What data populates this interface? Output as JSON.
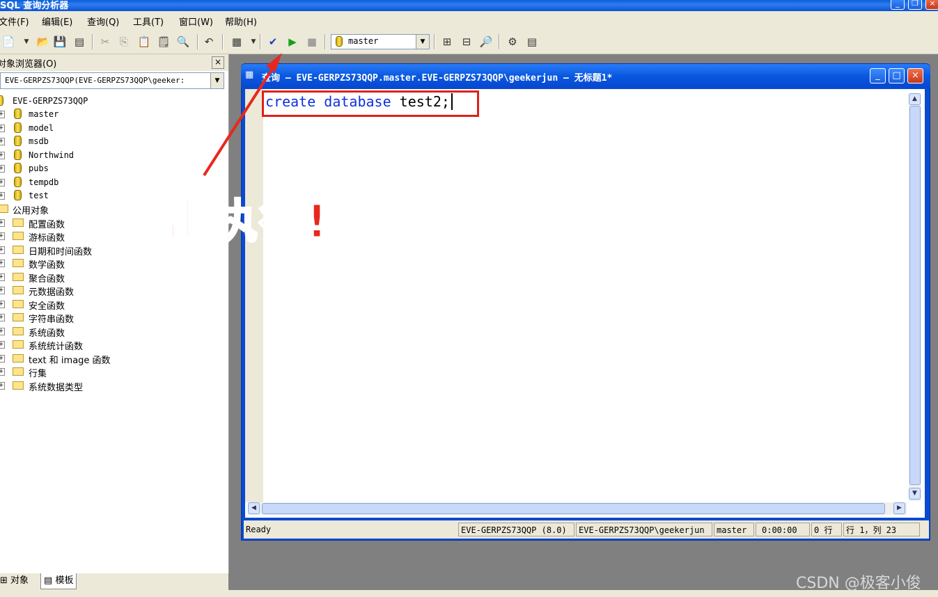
{
  "window": {
    "title": "SQL 查询分析器"
  },
  "menu": [
    "文件(F)",
    "编辑(E)",
    "查询(Q)",
    "工具(T)",
    "窗口(W)",
    "帮助(H)"
  ],
  "toolbar": {
    "database": "master"
  },
  "object_browser": {
    "title": "对象浏览器(O)",
    "close": "×",
    "server_select": "EVE-GERPZS73QQP(EVE-GERPZS73QQP\\geeker:",
    "root": "EVE-GERPZS73QQP",
    "databases": [
      "master",
      "model",
      "msdb",
      "Northwind",
      "pubs",
      "tempdb",
      "test"
    ],
    "common_objects": "公用对象",
    "folders": [
      "配置函数",
      "游标函数",
      "日期和时间函数",
      "数学函数",
      "聚合函数",
      "元数据函数",
      "安全函数",
      "字符串函数",
      "系统函数",
      "系统统计函数",
      "text 和 image 函数",
      "行集",
      "系统数据类型"
    ],
    "tabs": [
      "对象",
      "模板"
    ]
  },
  "query_window": {
    "title": "查询 — EVE-GERPZS73QQP.master.EVE-GERPZS73QQP\\geekerjun — 无标题1*",
    "code_kw1": "create",
    "code_kw2": "database",
    "code_rest": "test2;"
  },
  "status": {
    "state": "Ready",
    "server": "EVE-GERPZS73QQP (8.0)",
    "user": "EVE-GERPZS73QQP\\geekerjun",
    "db": "master",
    "time": "0:00:00",
    "rows": "0 行",
    "position": "行 1，列 23"
  },
  "annotation": {
    "text": "点击执行!",
    "color": "#e8281c"
  },
  "watermark": "CSDN @极客小俊"
}
